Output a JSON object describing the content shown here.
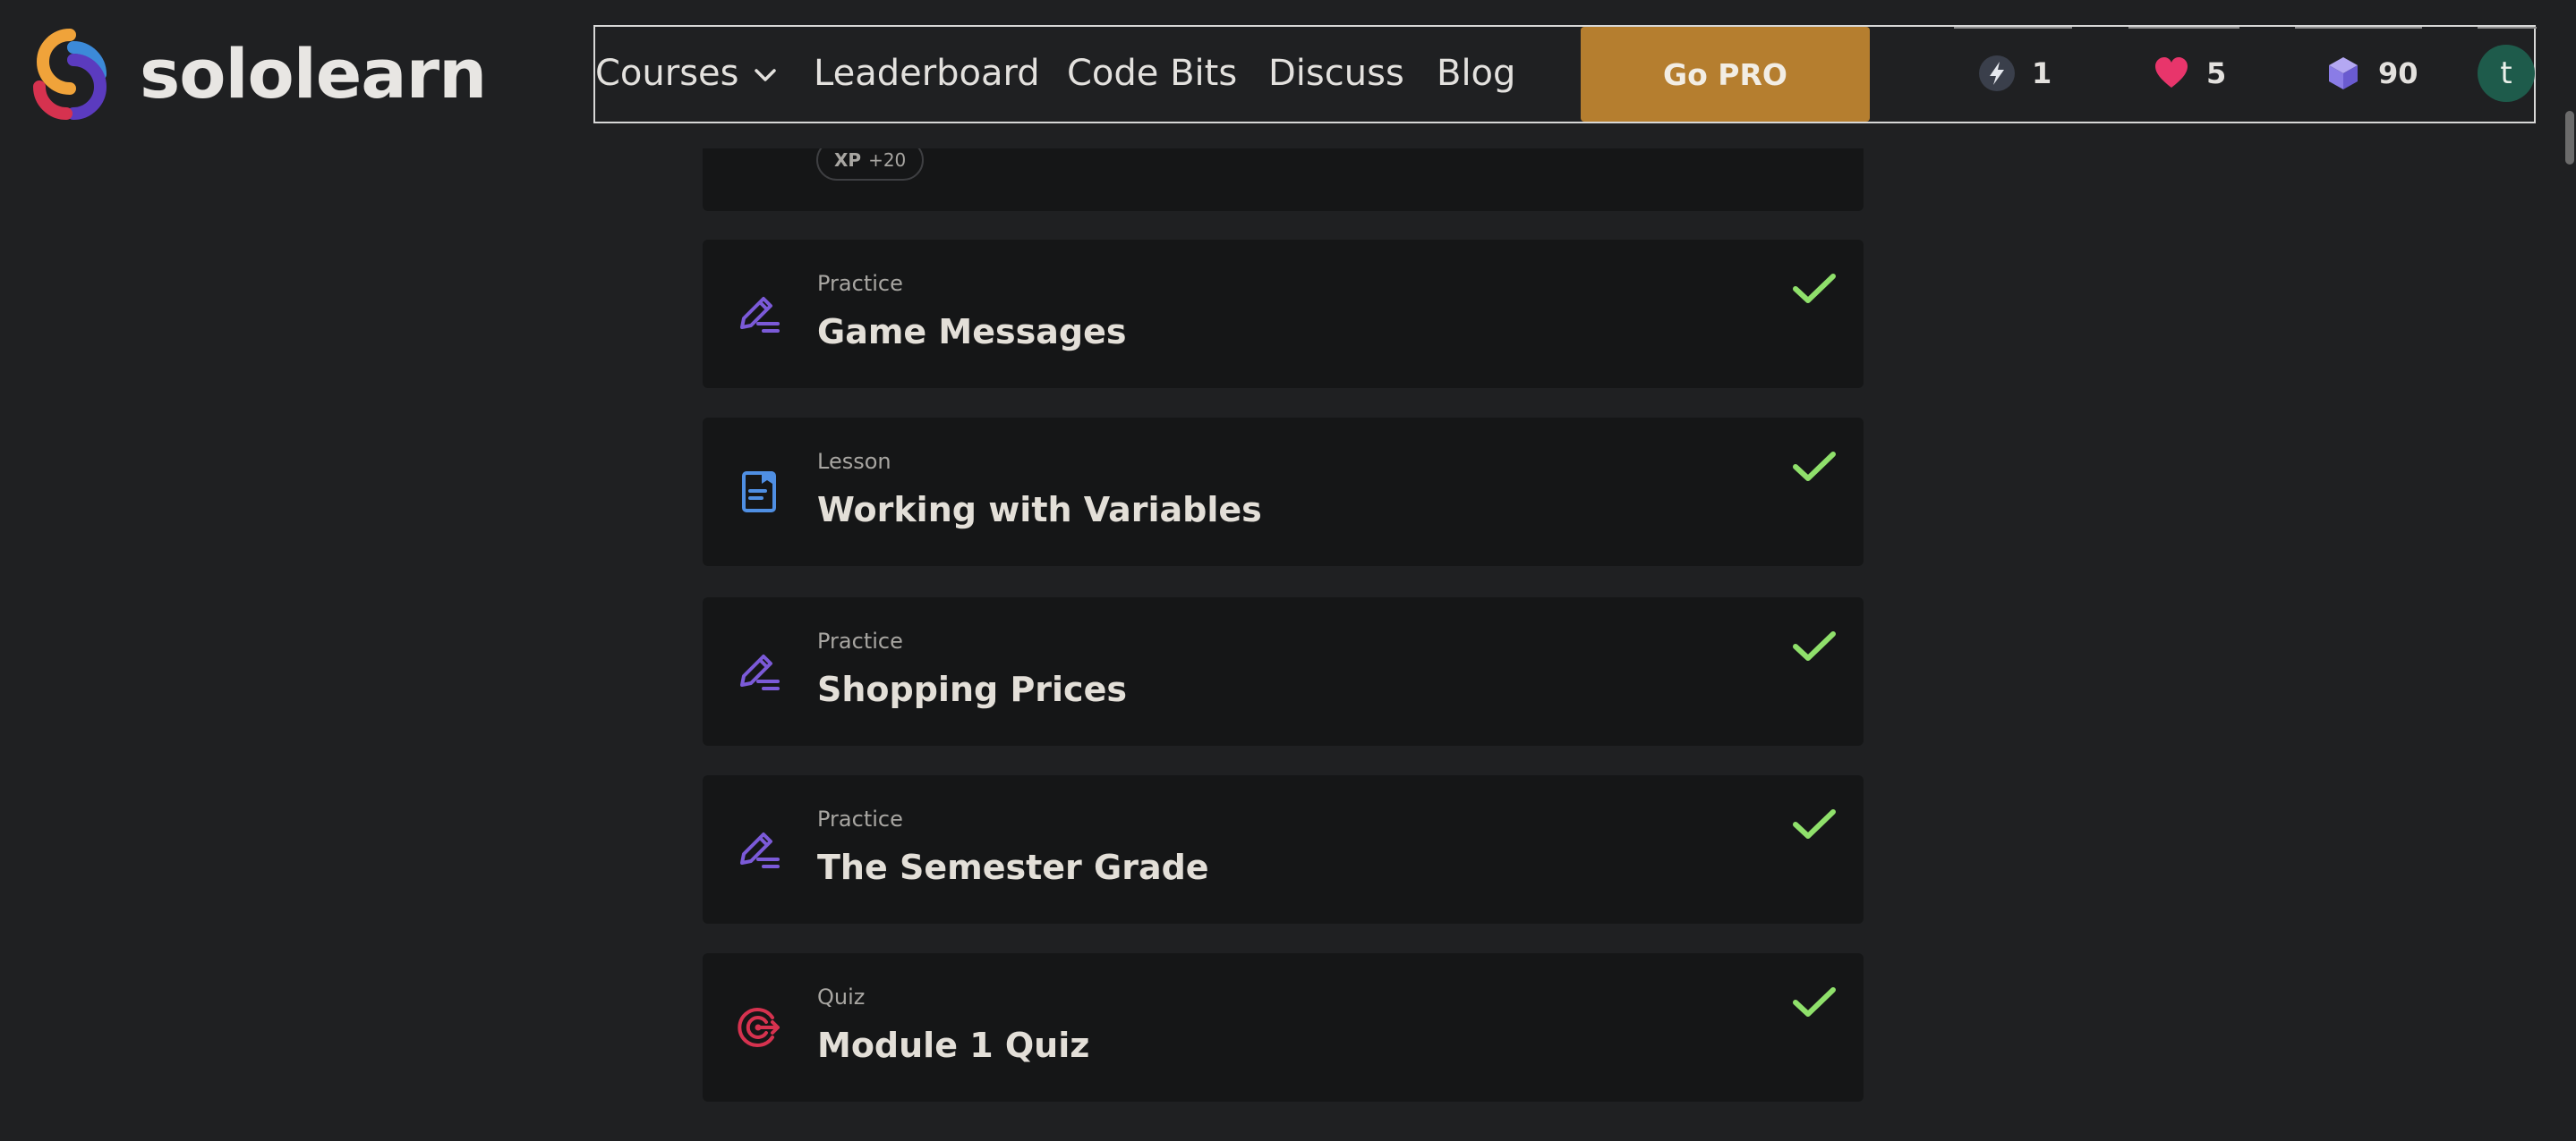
{
  "brand": {
    "name": "sololearn"
  },
  "nav": {
    "courses": "Courses",
    "leaderboard": "Leaderboard",
    "code_bits": "Code Bits",
    "discuss": "Discuss",
    "blog": "Blog",
    "go_pro": "Go PRO"
  },
  "stats": {
    "streak": "1",
    "hearts": "5",
    "gems": "90"
  },
  "user": {
    "initial": "t"
  },
  "previous_item": {
    "xp_label": "XP",
    "xp_value": "+20"
  },
  "lessons": [
    {
      "kind": "Practice",
      "title": "Game Messages",
      "icon": "practice-pencil-icon",
      "completed": true
    },
    {
      "kind": "Lesson",
      "title": "Working with Variables",
      "icon": "lesson-document-icon",
      "completed": true
    },
    {
      "kind": "Practice",
      "title": "Shopping Prices",
      "icon": "practice-pencil-icon",
      "completed": true
    },
    {
      "kind": "Practice",
      "title": "The Semester Grade",
      "icon": "practice-pencil-icon",
      "completed": true
    },
    {
      "kind": "Quiz",
      "title": "Module 1 Quiz",
      "icon": "quiz-target-icon",
      "completed": true
    }
  ],
  "colors": {
    "background": "#1f2022",
    "card": "#151617",
    "accent_pro": "#b57e2f",
    "check": "#8fe06b",
    "practice_icon": "#7b5ad8",
    "lesson_icon": "#4f8fe3",
    "quiz_icon": "#d6324f",
    "heart": "#e8356b",
    "gem": "#8a7ce6",
    "avatar": "#1e5b4b"
  }
}
